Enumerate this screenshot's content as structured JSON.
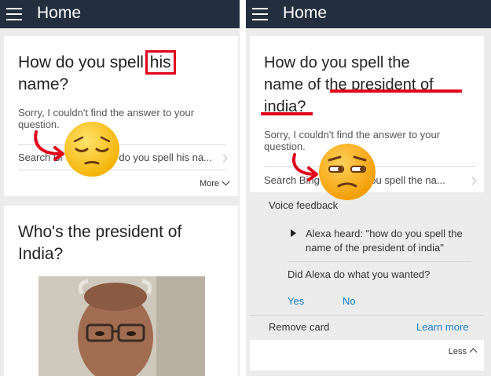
{
  "left": {
    "app_title": "Home",
    "card1": {
      "question_pre": "How do you spell ",
      "question_highlight": "his",
      "question_post": "name?",
      "answer": "Sorry, I couldn't find the answer to your question.",
      "search_left": "Search Bi",
      "search_right": "do you spell his na...",
      "more_label": "More"
    },
    "card2": {
      "question": "Who's the president of India?"
    }
  },
  "right": {
    "app_title": "Home",
    "question_line1": "How do you spell the",
    "question_line2_pre": "name of ",
    "question_line2_hl": "the president of",
    "question_line3": "india?",
    "answer": "Sorry, I couldn't find the answer to your question.",
    "search_left": "Search Bing",
    "search_right": "you spell the na...",
    "voice_feedback_label": "Voice feedback",
    "alexa_heard": "Alexa heard: \"how do you spell the name of the president of india\"",
    "did_alexa": "Did Alexa do what you wanted?",
    "yes": "Yes",
    "no": "No",
    "remove_card": "Remove card",
    "learn_more": "Learn more",
    "less_label": "Less"
  },
  "colors": {
    "appbar": "#232f3e",
    "highlight_red": "#e0001a",
    "link_blue": "#1a7bbf"
  },
  "icons": [
    "menu-icon",
    "chevron-right-icon",
    "chevron-down-icon",
    "chevron-up-icon",
    "play-triangle-icon",
    "pensive-face-emoji",
    "unamused-face-emoji",
    "red-arrow-icon"
  ]
}
